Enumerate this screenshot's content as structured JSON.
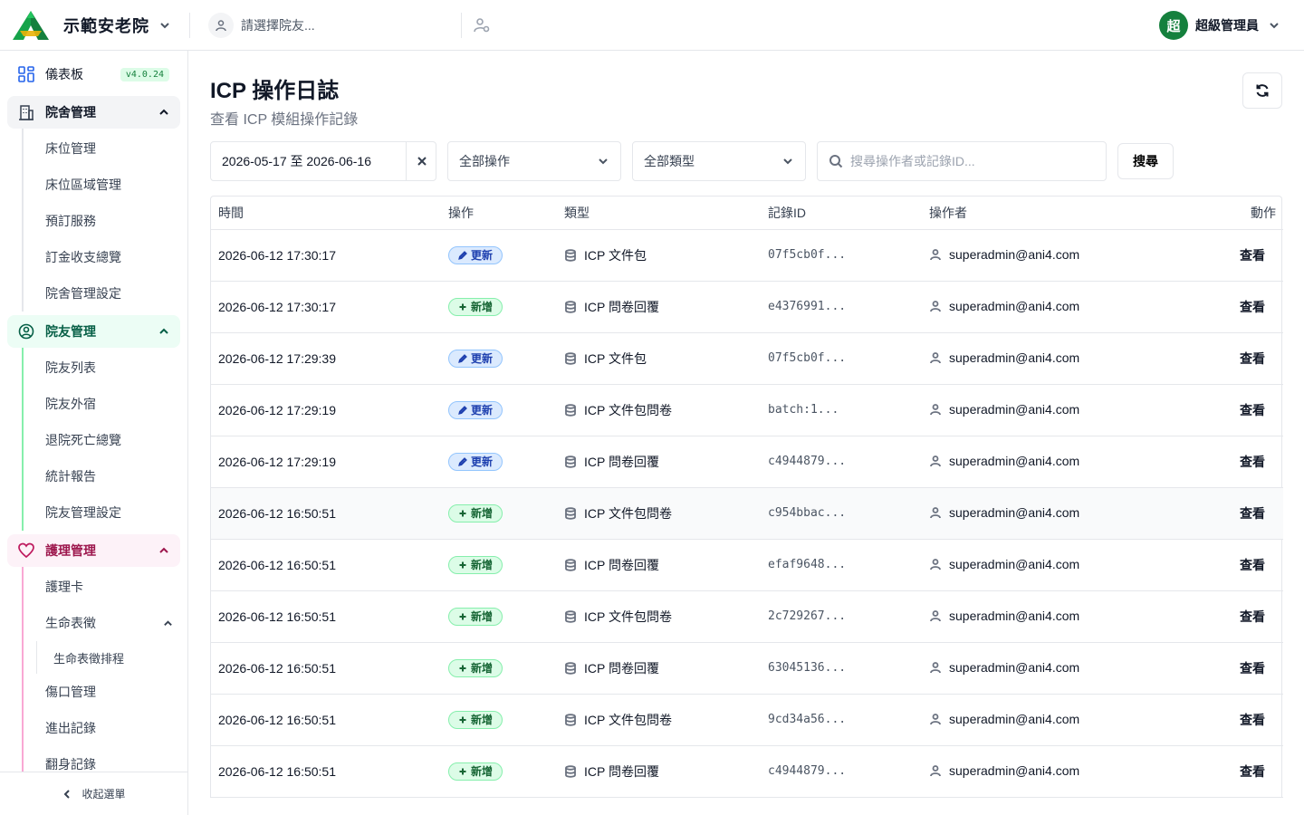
{
  "header": {
    "brand_name": "示範安老院",
    "resident_placeholder": "請選擇院友...",
    "user_avatar": "超",
    "user_name": "超級管理員"
  },
  "sidebar": {
    "dashboard_label": "儀表板",
    "version": "v4.0.24",
    "groups": [
      {
        "label": "院舍管理",
        "items": [
          "床位管理",
          "床位區域管理",
          "預訂服務",
          "訂金收支總覽",
          "院舍管理設定"
        ]
      },
      {
        "label": "院友管理",
        "items": [
          "院友列表",
          "院友外宿",
          "退院死亡總覽",
          "統計報告",
          "院友管理設定"
        ]
      },
      {
        "label": "護理管理",
        "items": [
          "護理卡",
          "生命表徵",
          "傷口管理",
          "進出記錄",
          "翻身記錄"
        ],
        "nested": "生命表徵排程"
      }
    ],
    "collapse_label": "收起選單"
  },
  "page": {
    "title": "ICP 操作日誌",
    "subtitle": "查看 ICP 模組操作記錄"
  },
  "filters": {
    "date_range": "2026-05-17 至 2026-06-16",
    "operation": "全部操作",
    "type": "全部類型",
    "search_placeholder": "搜尋操作者或記錄ID...",
    "search_button": "搜尋"
  },
  "table": {
    "headers": [
      "時間",
      "操作",
      "類型",
      "記錄ID",
      "操作者",
      "動作"
    ],
    "rows": [
      {
        "time": "2026-06-12 17:30:17",
        "op": "更新",
        "type": "ICP 文件包",
        "id": "07f5cb0f...",
        "user": "superadmin@ani4.com",
        "action": "查看"
      },
      {
        "time": "2026-06-12 17:30:17",
        "op": "新增",
        "type": "ICP 問卷回覆",
        "id": "e4376991...",
        "user": "superadmin@ani4.com",
        "action": "查看"
      },
      {
        "time": "2026-06-12 17:29:39",
        "op": "更新",
        "type": "ICP 文件包",
        "id": "07f5cb0f...",
        "user": "superadmin@ani4.com",
        "action": "查看"
      },
      {
        "time": "2026-06-12 17:29:19",
        "op": "更新",
        "type": "ICP 文件包問卷",
        "id": "batch:1...",
        "user": "superadmin@ani4.com",
        "action": "查看"
      },
      {
        "time": "2026-06-12 17:29:19",
        "op": "更新",
        "type": "ICP 問卷回覆",
        "id": "c4944879...",
        "user": "superadmin@ani4.com",
        "action": "查看"
      },
      {
        "time": "2026-06-12 16:50:51",
        "op": "新增",
        "type": "ICP 文件包問卷",
        "id": "c954bbac...",
        "user": "superadmin@ani4.com",
        "action": "查看"
      },
      {
        "time": "2026-06-12 16:50:51",
        "op": "新增",
        "type": "ICP 問卷回覆",
        "id": "efaf9648...",
        "user": "superadmin@ani4.com",
        "action": "查看"
      },
      {
        "time": "2026-06-12 16:50:51",
        "op": "新增",
        "type": "ICP 文件包問卷",
        "id": "2c729267...",
        "user": "superadmin@ani4.com",
        "action": "查看"
      },
      {
        "time": "2026-06-12 16:50:51",
        "op": "新增",
        "type": "ICP 問卷回覆",
        "id": "63045136...",
        "user": "superadmin@ani4.com",
        "action": "查看"
      },
      {
        "time": "2026-06-12 16:50:51",
        "op": "新增",
        "type": "ICP 文件包問卷",
        "id": "9cd34a56...",
        "user": "superadmin@ani4.com",
        "action": "查看"
      },
      {
        "time": "2026-06-12 16:50:51",
        "op": "新增",
        "type": "ICP 問卷回覆",
        "id": "c4944879...",
        "user": "superadmin@ani4.com",
        "action": "查看"
      }
    ]
  },
  "colors": {
    "brand_green": "#15803d",
    "update_badge": "#dbeafe",
    "create_badge": "#dcfce7"
  }
}
